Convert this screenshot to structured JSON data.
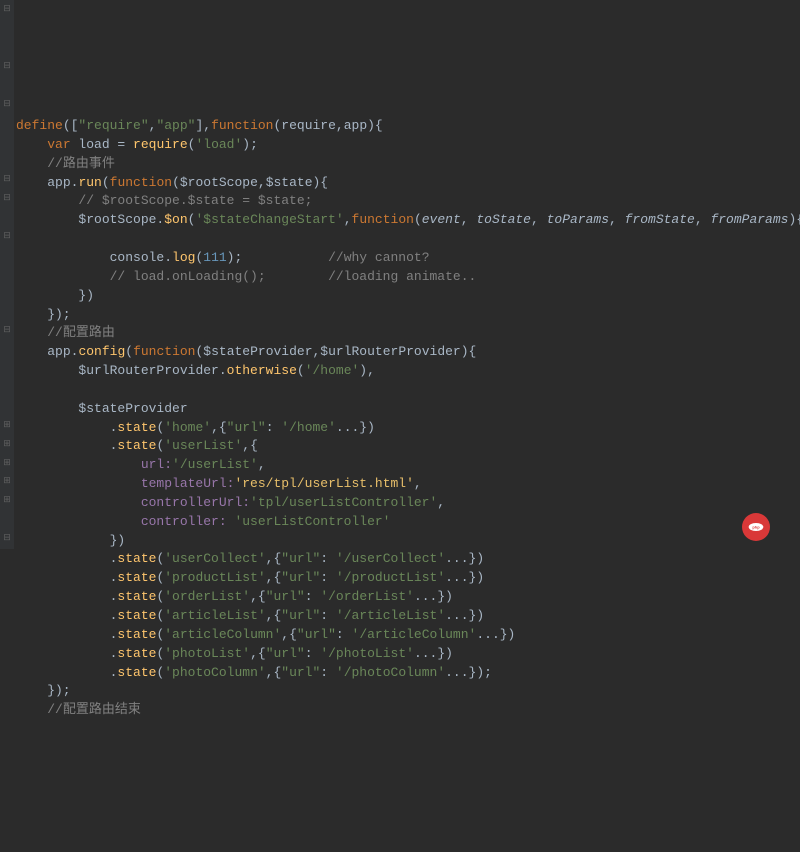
{
  "code": {
    "l1_define": "define",
    "l1_req": "\"require\"",
    "l1_app": "\"app\"",
    "l1_function": "function",
    "l1_params": "(require,app){",
    "l2_var": "var",
    "l2_load": " load = ",
    "l2_require": "require",
    "l2_loadstr": "'load'",
    "l3_comment": "//路由事件",
    "l4_app": "app.",
    "l4_run": "run",
    "l4_function": "function",
    "l4_params": "($rootScope,$state){",
    "l5_comment": "// $rootScope.$state = $state;",
    "l6_root": "$rootScope.",
    "l6_on": "$on",
    "l6_event": "'$stateChangeStart'",
    "l6_function": "function",
    "l6_p1": "event",
    "l6_p2": "toState",
    "l6_p3": "toParams",
    "l6_p4": "fromState",
    "l6_p5": "fromParams",
    "l8_console": "console.",
    "l8_log": "log",
    "l8_num": "111",
    "l8_comment": "//why cannot?",
    "l9_comment1": "// load.onLoading();",
    "l9_comment2": "//loading animate..",
    "l12_comment": "//配置路由",
    "l13_app": "app.",
    "l13_config": "config",
    "l13_function": "function",
    "l13_params": "($stateProvider,$urlRouterProvider){",
    "l14_url": "$urlRouterProvider.",
    "l14_otherwise": "otherwise",
    "l14_home": "'/home'",
    "l16_sp": "$stateProvider",
    "l17_state": "state",
    "l17_home": "'home'",
    "l17_url": "\"url\"",
    "l17_homeurl": "'/home'",
    "l18_state": "state",
    "l18_userlist": "'userList'",
    "l19_url": "url:",
    "l19_val": "'/userList'",
    "l20_tpl": "templateUrl:",
    "l20_val": "'res/tpl/userList.h",
    "l20_val2": "tml'",
    "l21_ctrl": "controllerUrl:",
    "l21_val": "'tpl/userListController'",
    "l22_ctrl": "controller: ",
    "l22_val": "'userListController'",
    "l24_state": "state",
    "l24_name": "'userCollect'",
    "l24_url": "\"url\"",
    "l24_val": "'/userCollect'",
    "l25_state": "state",
    "l25_name": "'productList'",
    "l25_url": "\"url\"",
    "l25_val": "'/productList'",
    "l26_state": "state",
    "l26_name": "'orderList'",
    "l26_url": "\"url\"",
    "l26_val": "'/orderList'",
    "l27_state": "state",
    "l27_name": "'articleList'",
    "l27_url": "\"url\"",
    "l27_val": "'/articleList'",
    "l28_state": "state",
    "l28_name": "'articleColumn'",
    "l28_url": "\"url\"",
    "l28_val": "'/articleColumn'",
    "l29_state": "state",
    "l29_name": "'photoList'",
    "l29_url": "\"url\"",
    "l29_val": "'/photoList'",
    "l30_state": "state",
    "l30_name": "'photoColumn'",
    "l30_url": "\"url\"",
    "l30_val": "'/photoColumn'",
    "l32_comment": "//配置路由结束"
  }
}
